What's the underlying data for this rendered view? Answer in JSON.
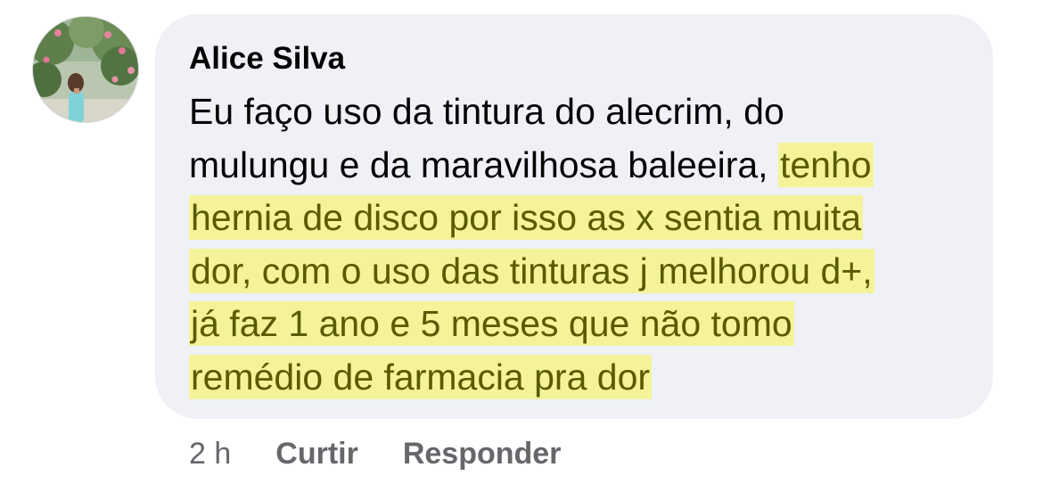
{
  "comment": {
    "author": "Alice Silva",
    "text_lines": [
      "Eu faço uso da tintura do alecrim, do",
      "mulungu e da maravilhosa baleeira, "
    ],
    "highlighted_lines": [
      "tenho",
      "hernia de disco por isso as x sentia muita",
      "dor, com o uso das tinturas j melhorou d+,",
      "já faz 1 ano e 5 meses que não tomo",
      "remédio de farmacia pra dor"
    ]
  },
  "actions": {
    "time": "2 h",
    "like_label": "Curtir",
    "reply_label": "Responder"
  },
  "colors": {
    "bubble_bg": "#eff1f6",
    "highlight_bg": "#f4f39a",
    "highlight_text": "#5a5a00",
    "meta_text": "#65676b"
  },
  "icons": {
    "avatar": "profile-photo-avatar"
  }
}
